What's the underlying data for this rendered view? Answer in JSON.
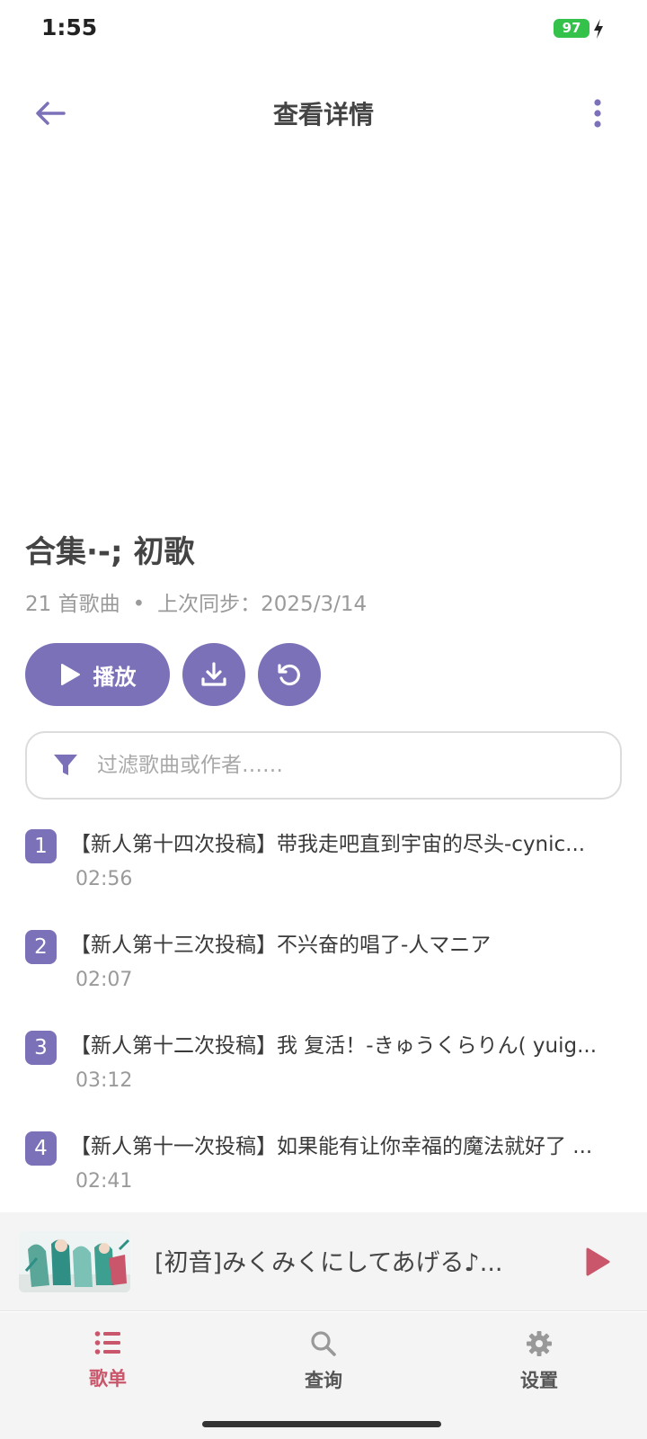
{
  "status_bar": {
    "time": "1:55",
    "battery": "97"
  },
  "header": {
    "title": "查看详情"
  },
  "playlist": {
    "title": "合集·-; 初歌",
    "song_count": "21 首歌曲",
    "separator": "•",
    "last_sync": "上次同步：2025/3/14"
  },
  "actions": {
    "play_label": "播放"
  },
  "filter": {
    "placeholder": "过滤歌曲或作者……"
  },
  "songs": [
    {
      "index": "1",
      "title": "【新人第十四次投稿】带我走吧直到宇宙的尽头-cynic...",
      "duration": "02:56"
    },
    {
      "index": "2",
      "title": "【新人第十三次投稿】不兴奋的唱了-人マニア",
      "duration": "02:07"
    },
    {
      "index": "3",
      "title": "【新人第十二次投稿】我 复活！-きゅうくらりん( yuig...",
      "duration": "03:12"
    },
    {
      "index": "4",
      "title": "【新人第十一次投稿】如果能有让你幸福的魔法就好了 ...",
      "duration": "02:41"
    }
  ],
  "now_playing": {
    "title": "[初音]みくみくにしてあげる♪..."
  },
  "nav": {
    "items": [
      {
        "label": "歌单",
        "icon": "list-icon"
      },
      {
        "label": "查询",
        "icon": "search-icon"
      },
      {
        "label": "设置",
        "icon": "gear-icon"
      }
    ]
  },
  "colors": {
    "accent": "#7b71b8",
    "nav_active": "#c9566a",
    "battery": "#34c24a"
  }
}
